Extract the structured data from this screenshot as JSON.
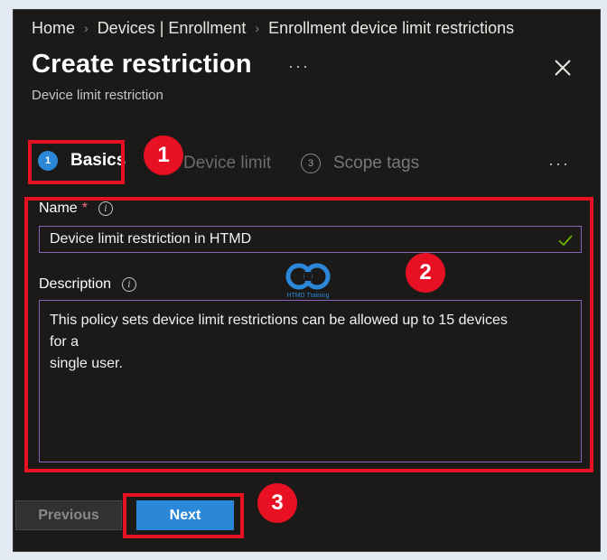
{
  "breadcrumb": {
    "items": [
      "Home",
      "Devices | Enrollment",
      "Enrollment device limit restrictions"
    ]
  },
  "header": {
    "title": "Create restriction",
    "more_label": "···",
    "subtitle": "Device limit restriction"
  },
  "tabs": [
    {
      "step": "1",
      "label": "Basics",
      "active": true
    },
    {
      "step": "",
      "label": "Device limit",
      "active": false
    },
    {
      "step": "3",
      "label": "Scope tags",
      "active": false
    }
  ],
  "tabs_more_label": "···",
  "form": {
    "name_label": "Name",
    "required_mark": "*",
    "name_value": "Device limit restriction in HTMD",
    "description_label": "Description",
    "description_value": "This policy sets device limit restrictions can be allowed up to 15 devices\nfor a\nsingle user."
  },
  "watermark": {
    "text": "HTMD Training"
  },
  "annotations": {
    "badge1": "1",
    "badge2": "2",
    "badge3": "3"
  },
  "footer": {
    "previous_label": "Previous",
    "next_label": "Next"
  },
  "colors": {
    "accent": "#2b88d8",
    "annotation_red": "#e81123",
    "input_border": "#8764b8",
    "valid_check": "#6bb700"
  }
}
